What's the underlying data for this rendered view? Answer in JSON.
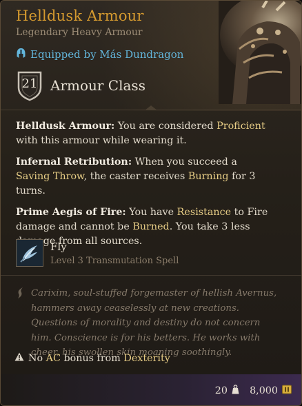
{
  "item": {
    "name": "Helldusk Armour",
    "type": "Legendary Heavy Armour",
    "equipped_text": "Equipped by Más Dundragon"
  },
  "armour_class": {
    "value": "21",
    "label": "Armour Class"
  },
  "properties": [
    {
      "name": "Helldusk Armour:",
      "pre": " You are considered ",
      "hl1": "Proficient",
      "mid": " with this armour while wearing it.",
      "hl2": "",
      "post": ""
    },
    {
      "name": "Infernal Retribution:",
      "pre": " When you succeed a ",
      "hl1": "Saving Throw",
      "mid": ", the caster receives ",
      "hl2": "Burning",
      "post": " for 3 turns."
    },
    {
      "name": "Prime Aegis of Fire:",
      "pre": " You have ",
      "hl1": "Resistance",
      "mid": " to Fire damage and cannot be ",
      "hl2": "Burned",
      "post": ". You take 3 less damage from all sources."
    }
  ],
  "spell": {
    "name": "Fly",
    "level": "Level 3 Transmutation Spell",
    "icon": "fly-spell-icon"
  },
  "flavor_text": "Carixim, soul-stuffed forgemaster of hellish Avernus, hammers away ceaselessly at new creations. Questions of morality and destiny do not concern him. Conscience is for his betters. He works with cheer, his swollen skin moaning soothingly.",
  "warning": {
    "pre": "No ",
    "ac": "AC",
    "mid": " bonus from ",
    "stat": "Dexterity"
  },
  "footer": {
    "weight": "20",
    "price": "8,000"
  },
  "colors": {
    "title": "#d59a2f",
    "equipped": "#63b6dc",
    "highlight": "#e7cd86",
    "flavor": "#85796a"
  }
}
